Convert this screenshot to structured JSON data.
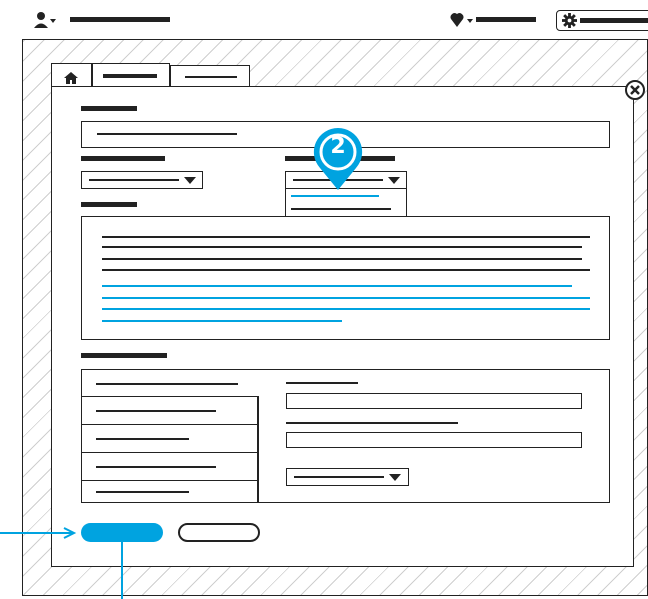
{
  "title": "",
  "colors": {
    "accent": "#00a3e0",
    "ink": "#222222"
  },
  "header": {
    "icons": [
      "user-icon",
      "chevron-down-icon",
      "heart-icon",
      "chevron-down-icon",
      "gear-icon"
    ]
  },
  "tabs": [
    {
      "icon": "home-icon"
    },
    {
      "icon": ""
    },
    {
      "icon": ""
    }
  ],
  "dropdown_open": {
    "options_count": 3,
    "highlighted_index": 0
  },
  "step_badge": {
    "number": "2"
  },
  "close_icon": "close-icon"
}
